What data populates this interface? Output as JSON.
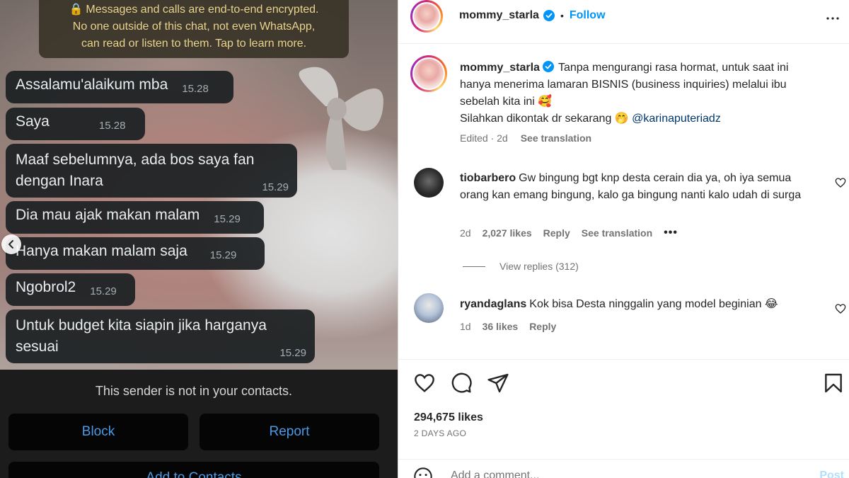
{
  "chat": {
    "encryption_notice": [
      "Messages and calls are end-to-end encrypted.",
      "No one outside of this chat, not even WhatsApp,",
      "can read or listen to them. Tap to learn more."
    ],
    "messages": [
      {
        "lines": [
          "Assalamu'alaikum mba"
        ],
        "time": "15.28"
      },
      {
        "lines": [
          "Saya"
        ],
        "time": "15.28"
      },
      {
        "lines": [
          "Maaf sebelumnya, ada bos saya fan",
          "dengan Inara"
        ],
        "time": "15.29"
      },
      {
        "lines": [
          "Dia mau ajak makan malam"
        ],
        "time": "15.29"
      },
      {
        "lines": [
          "Hanya makan malam saja"
        ],
        "time": "15.29"
      },
      {
        "lines": [
          "Ngobrol2"
        ],
        "time": "15.29"
      },
      {
        "lines": [
          "Untuk budget kita siapin jika harganya",
          "sesuai"
        ],
        "time": "15.29"
      }
    ],
    "sender_note": "This sender is not in your contacts.",
    "block_label": "Block",
    "report_label": "Report",
    "add_contacts_label": "Add to Contacts"
  },
  "post": {
    "username": "mommy_starla",
    "follow_label": "Follow",
    "caption_lines": [
      "Tanpa mengurangi rasa hormat, untuk saat ini",
      "hanya menerima lamaran BISNIS (business inquiries) melalui ibu",
      "sebelah kita ini 🥰"
    ],
    "caption_line4": "Silahkan dikontak dr sekarang 🤭",
    "mention": "@karinaputeriadz",
    "edited": "Edited · 2d",
    "see_translation": "See translation",
    "comments": [
      {
        "username": "tiobarbero",
        "text": "Gw bingung bgt knp desta cerain dia ya, oh iya semua orang kan emang bingung, kalo ga bingung nanti kalo udah di surga",
        "age": "2d",
        "likes": "2,027 likes",
        "reply": "Reply",
        "see_translation": "See translation",
        "view_replies": "View replies (312)"
      },
      {
        "username": "ryandaglans",
        "text": "Kok bisa Desta ninggalin yang model beginian 😂",
        "age": "1d",
        "likes": "36 likes",
        "reply": "Reply"
      }
    ],
    "likes_count": "294,675 likes",
    "date": "2 DAYS AGO",
    "comment_placeholder": "Add a comment...",
    "post_label": "Post"
  },
  "colors": {
    "accent": "#0095f6",
    "mention": "#00376b",
    "whatsapp_link": "#4a9ae6",
    "encryption_text": "#e8d48e"
  }
}
